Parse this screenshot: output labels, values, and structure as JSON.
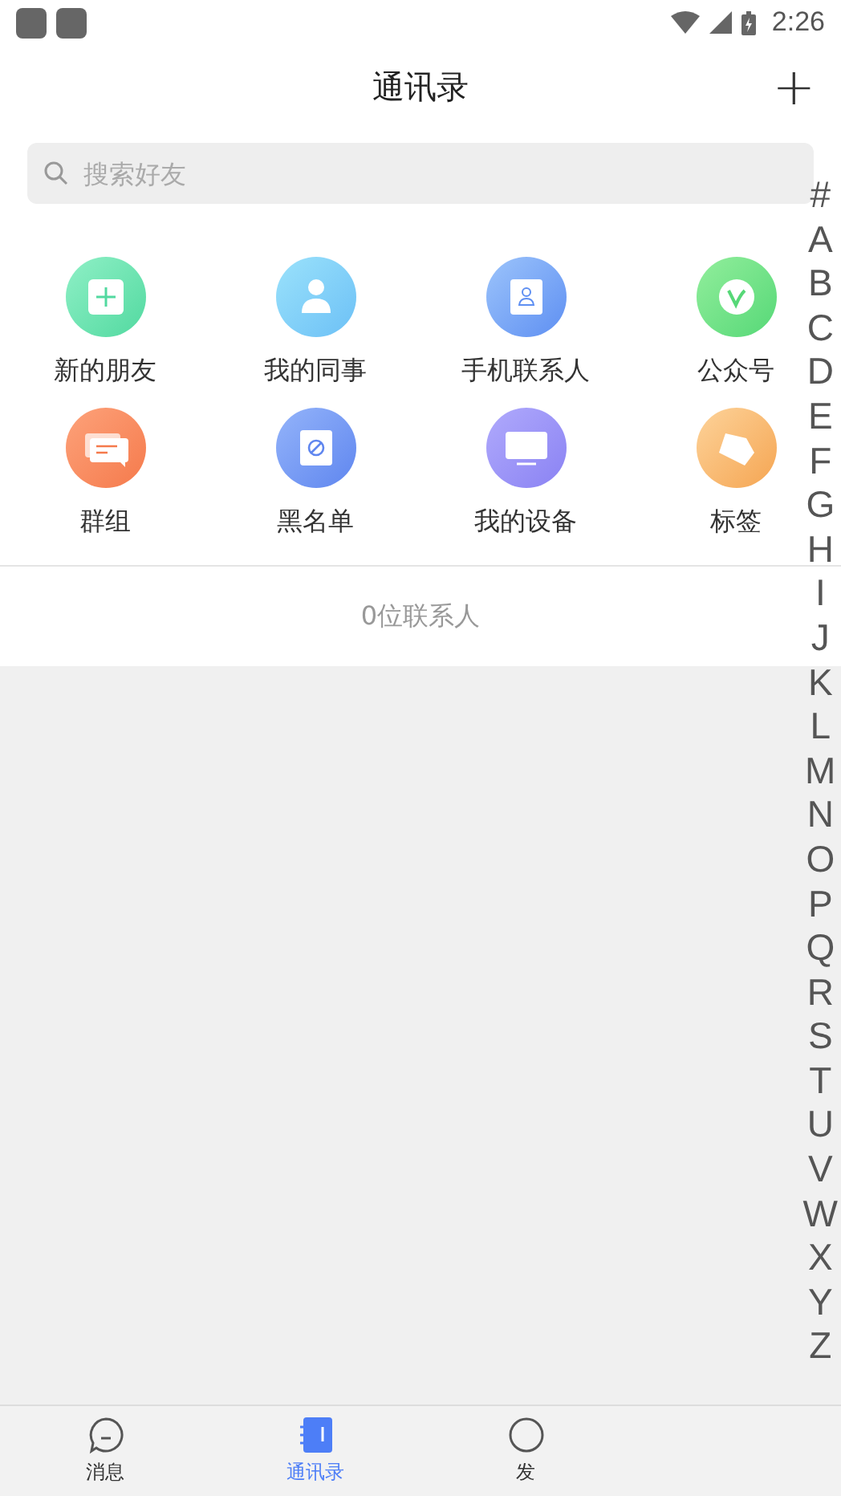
{
  "status_bar": {
    "time": "2:26"
  },
  "header": {
    "title": "通讯录",
    "add_icon": "+"
  },
  "search": {
    "placeholder": "搜索好友"
  },
  "shortcuts": [
    {
      "kind": "new-friend",
      "label": "新的朋友"
    },
    {
      "kind": "colleague",
      "label": "我的同事"
    },
    {
      "kind": "phone-contact",
      "label": "手机联系人"
    },
    {
      "kind": "official",
      "label": "公众号"
    },
    {
      "kind": "group",
      "label": "群组"
    },
    {
      "kind": "blacklist",
      "label": "黑名单"
    },
    {
      "kind": "device",
      "label": "我的设备"
    },
    {
      "kind": "tag",
      "label": "标签"
    }
  ],
  "contact_count": "0位联系人",
  "index": [
    "#",
    "A",
    "B",
    "C",
    "D",
    "E",
    "F",
    "G",
    "H",
    "I",
    "J",
    "K",
    "L",
    "M",
    "N",
    "O",
    "P",
    "Q",
    "R",
    "S",
    "T",
    "U",
    "V",
    "W",
    "X",
    "Y",
    "Z"
  ],
  "tabs": [
    {
      "kind": "message",
      "label": "消息",
      "selected": false
    },
    {
      "kind": "contacts",
      "label": "通讯录",
      "selected": true
    },
    {
      "kind": "discover",
      "label": "发",
      "selected": false
    }
  ]
}
